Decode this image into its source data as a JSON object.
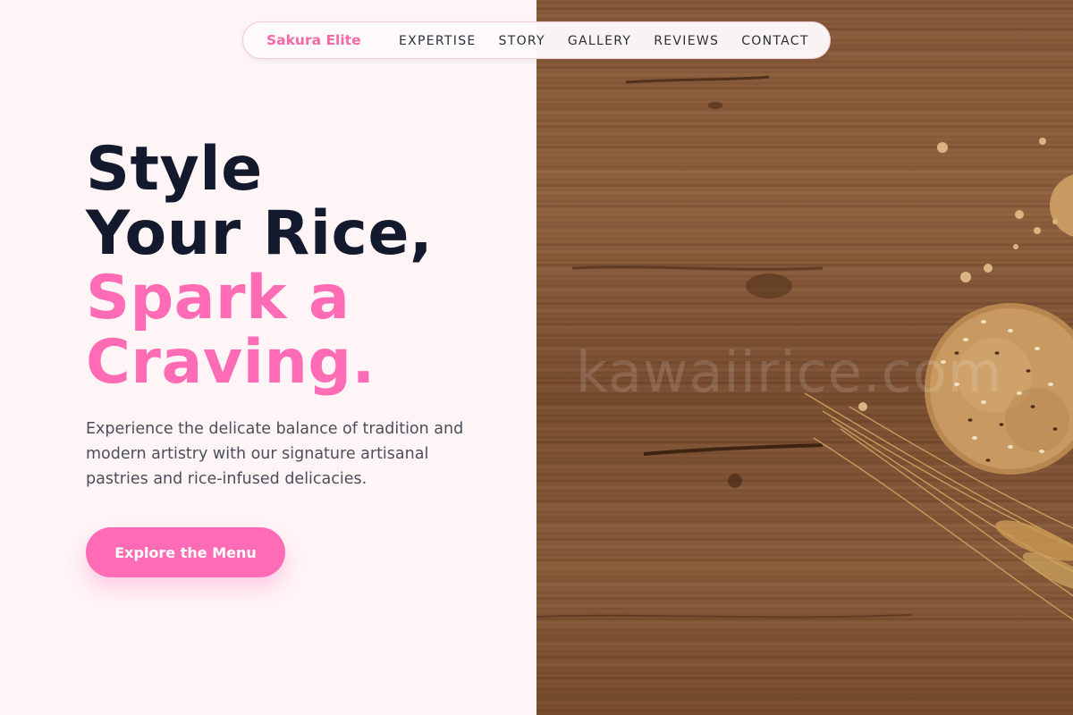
{
  "nav": {
    "brand": "Sakura Elite",
    "links": [
      "EXPERTISE",
      "STORY",
      "GALLERY",
      "REVIEWS",
      "CONTACT"
    ]
  },
  "hero": {
    "title_line1": "Style",
    "title_line2": "Your Rice,",
    "title_line3": "Spark a",
    "title_line4": "Craving.",
    "description": "Experience the delicate balance of tradition and modern artistry with our signature artisanal pastries and rice-infused delicacies.",
    "cta_label": "Explore the Menu"
  },
  "image": {
    "watermark": "kawaiirice.com"
  },
  "colors": {
    "accent": "#ff6bb4",
    "heading": "#141a2e",
    "background": "#fff4f6"
  }
}
